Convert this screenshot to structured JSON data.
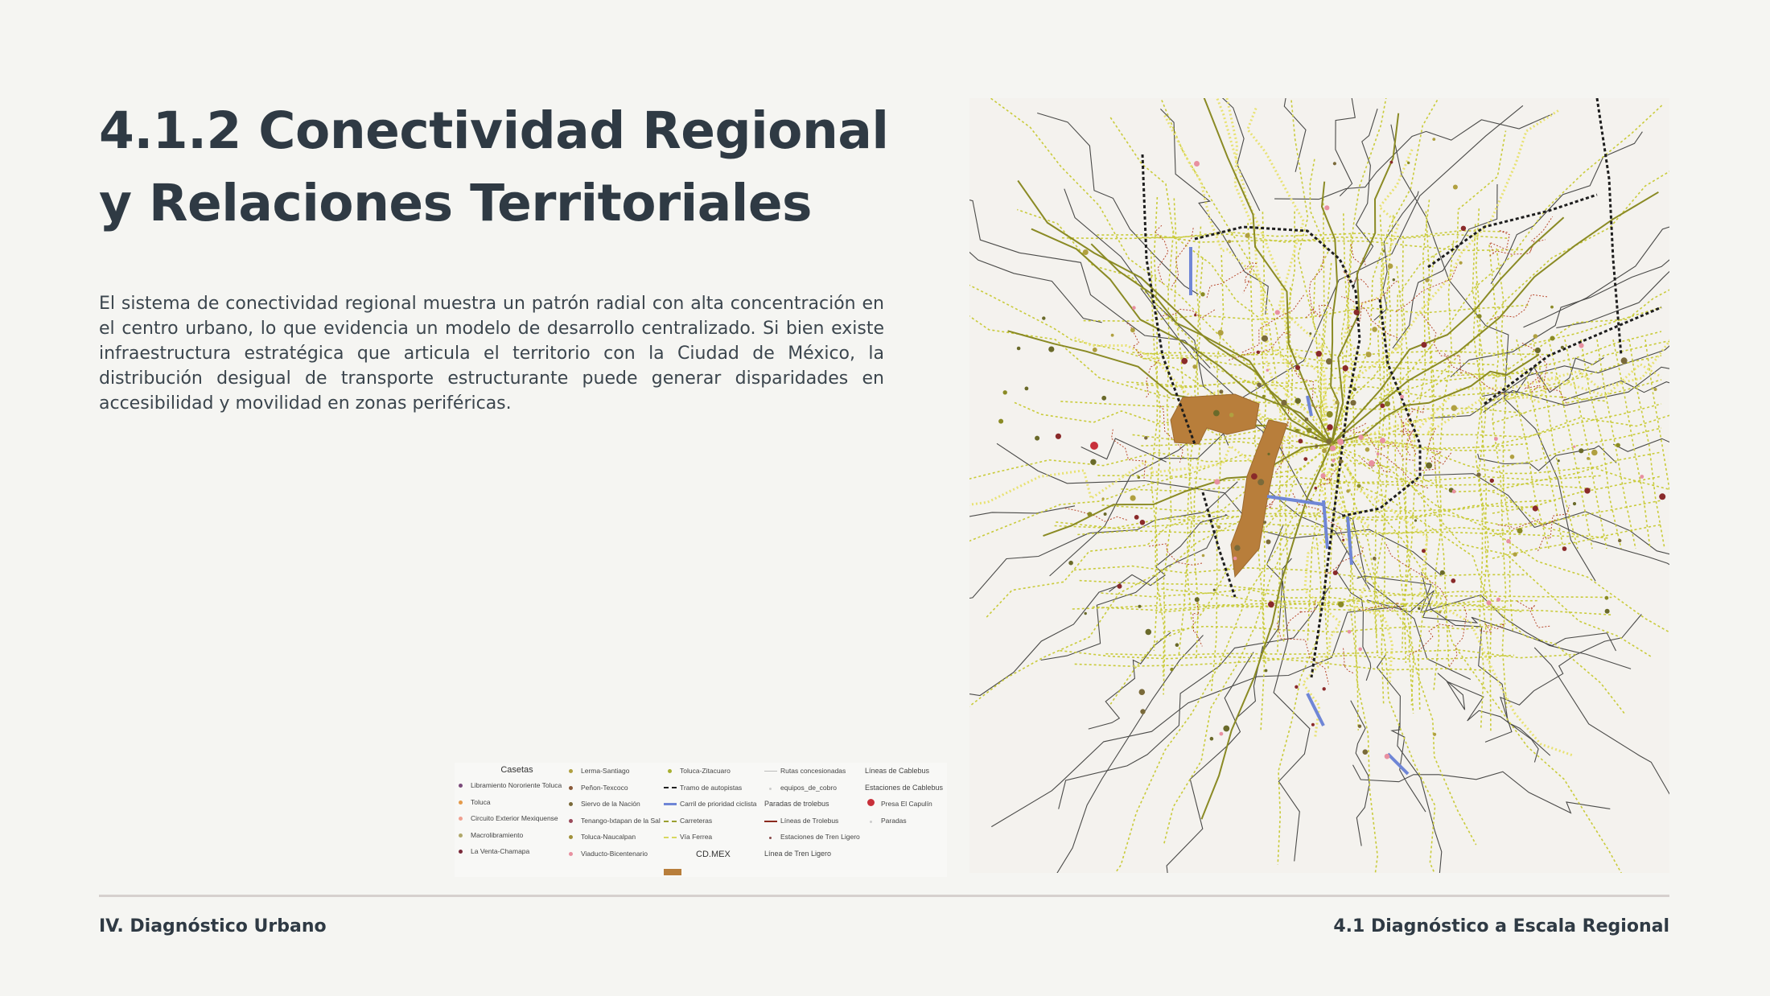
{
  "page": {
    "title": "4.1.2 Conectividad Regional y Relaciones Territoriales",
    "body": "El sistema de conectividad regional muestra un patrón radial con alta concentración en el centro urbano, lo que evidencia un modelo de desarrollo centralizado. Si bien existe infraestructura estratégica que articula el territorio con la Ciudad de México, la distribución desigual de transporte estructurante puede generar disparidades en accesibilidad y movilidad en zonas periféricas."
  },
  "legend": {
    "col1": {
      "header": "Casetas",
      "items": [
        "Libramiento Nororiente Toluca",
        "Toluca",
        "Circuito Exterior Mexiquense",
        "Macrolibramiento",
        "La Venta-Chamapa"
      ]
    },
    "col2": {
      "items": [
        "Lerma-Santiago",
        "Peñon-Texcoco",
        "Siervo de la Nación",
        "Tenango-Ixtapan de la Sal",
        "Toluca-Naucalpan",
        "Viaducto-Bicentenario"
      ]
    },
    "col3": {
      "items": [
        "Toluca-Zitacuaro",
        "Tramo de autopistas",
        "Carril de prioridad ciclista",
        "Carreteras",
        "Vía Ferrea"
      ],
      "cdmx": "CD.MEX"
    },
    "col4": {
      "items": [
        "Rutas concesionadas",
        "equipos_de_cobro",
        "Paradas de trolebus",
        "Líneas de Trolebus",
        "Estaciones de Tren Ligero",
        "Línea de Tren Ligero"
      ]
    },
    "col5": {
      "items": [
        "Líneas de Cablebus",
        "Estaciones de Cablebus",
        "Presa El Capulín",
        "Paradas"
      ]
    }
  },
  "colors": {
    "text": "#2f3a44",
    "background": "#f5f5f2",
    "cdmx": "#b87e3b",
    "road": "#c9cb3a",
    "railway": "#e3e06a",
    "trolleybus": "#8b2a1e",
    "bike_lane": "#6f86d6"
  },
  "footer": {
    "left": "IV. Diagnóstico Urbano",
    "right": "4.1 Diagnóstico a Escala Regional"
  }
}
